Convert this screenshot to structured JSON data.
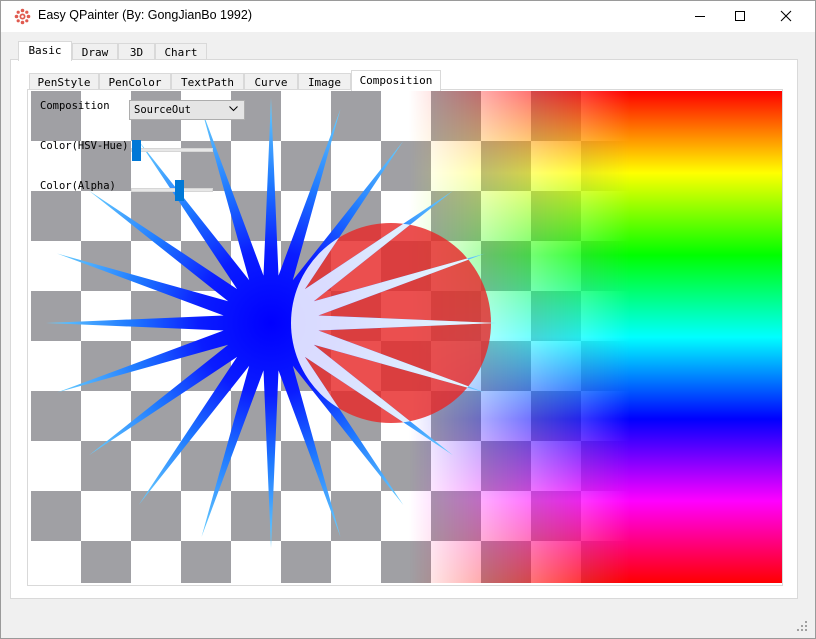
{
  "window": {
    "title": "Easy QPainter (By: GongJianBo 1992)",
    "controls": [
      "minimize-icon",
      "maximize-icon",
      "close-icon"
    ]
  },
  "main_tabs": [
    {
      "label": "Basic",
      "active": true
    },
    {
      "label": "Draw",
      "active": false
    },
    {
      "label": "3D",
      "active": false
    },
    {
      "label": "Chart",
      "active": false
    }
  ],
  "sub_tabs": [
    {
      "label": "PenStyle",
      "active": false
    },
    {
      "label": "PenColor",
      "active": false
    },
    {
      "label": "TextPath",
      "active": false
    },
    {
      "label": "Curve",
      "active": false
    },
    {
      "label": "Image",
      "active": false
    },
    {
      "label": "Composition",
      "active": true
    }
  ],
  "controls": {
    "composition_label": "Composition",
    "composition_value": "SourceOut",
    "hue_label": "Color(HSV-Hue)",
    "hue_value": 0.02,
    "alpha_label": "Color(Alpha)",
    "alpha_value": 0.6
  },
  "colors": {
    "accent": "#0078d7",
    "checker_dark": "#a0a0a4",
    "checker_light": "#ffffff",
    "star_blue": "#0000ff",
    "star_tip": "#50b4ff",
    "circle_red": "#e62828"
  }
}
